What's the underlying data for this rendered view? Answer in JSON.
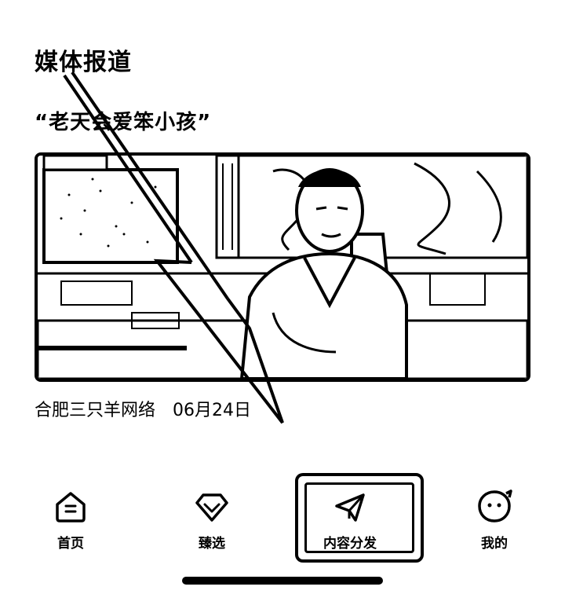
{
  "section": {
    "title": "媒体报道"
  },
  "article": {
    "title": "“老天会爱笨小孩”",
    "source": "合肥三只羊网络",
    "date": "06月24日"
  },
  "tabs": [
    {
      "label": "首页",
      "icon": "home-icon"
    },
    {
      "label": "臻选",
      "icon": "diamond-icon"
    },
    {
      "label": "内容分发",
      "icon": "paper-plane-icon"
    },
    {
      "label": "我的",
      "icon": "chat-face-icon"
    }
  ]
}
